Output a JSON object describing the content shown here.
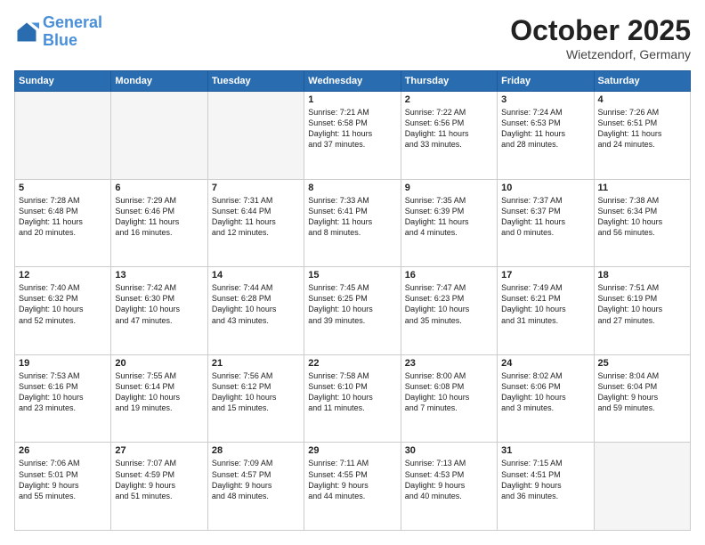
{
  "header": {
    "logo_line1": "General",
    "logo_line2": "Blue",
    "month": "October 2025",
    "location": "Wietzendorf, Germany"
  },
  "weekdays": [
    "Sunday",
    "Monday",
    "Tuesday",
    "Wednesday",
    "Thursday",
    "Friday",
    "Saturday"
  ],
  "weeks": [
    [
      {
        "day": "",
        "text": ""
      },
      {
        "day": "",
        "text": ""
      },
      {
        "day": "",
        "text": ""
      },
      {
        "day": "1",
        "text": "Sunrise: 7:21 AM\nSunset: 6:58 PM\nDaylight: 11 hours\nand 37 minutes."
      },
      {
        "day": "2",
        "text": "Sunrise: 7:22 AM\nSunset: 6:56 PM\nDaylight: 11 hours\nand 33 minutes."
      },
      {
        "day": "3",
        "text": "Sunrise: 7:24 AM\nSunset: 6:53 PM\nDaylight: 11 hours\nand 28 minutes."
      },
      {
        "day": "4",
        "text": "Sunrise: 7:26 AM\nSunset: 6:51 PM\nDaylight: 11 hours\nand 24 minutes."
      }
    ],
    [
      {
        "day": "5",
        "text": "Sunrise: 7:28 AM\nSunset: 6:48 PM\nDaylight: 11 hours\nand 20 minutes."
      },
      {
        "day": "6",
        "text": "Sunrise: 7:29 AM\nSunset: 6:46 PM\nDaylight: 11 hours\nand 16 minutes."
      },
      {
        "day": "7",
        "text": "Sunrise: 7:31 AM\nSunset: 6:44 PM\nDaylight: 11 hours\nand 12 minutes."
      },
      {
        "day": "8",
        "text": "Sunrise: 7:33 AM\nSunset: 6:41 PM\nDaylight: 11 hours\nand 8 minutes."
      },
      {
        "day": "9",
        "text": "Sunrise: 7:35 AM\nSunset: 6:39 PM\nDaylight: 11 hours\nand 4 minutes."
      },
      {
        "day": "10",
        "text": "Sunrise: 7:37 AM\nSunset: 6:37 PM\nDaylight: 11 hours\nand 0 minutes."
      },
      {
        "day": "11",
        "text": "Sunrise: 7:38 AM\nSunset: 6:34 PM\nDaylight: 10 hours\nand 56 minutes."
      }
    ],
    [
      {
        "day": "12",
        "text": "Sunrise: 7:40 AM\nSunset: 6:32 PM\nDaylight: 10 hours\nand 52 minutes."
      },
      {
        "day": "13",
        "text": "Sunrise: 7:42 AM\nSunset: 6:30 PM\nDaylight: 10 hours\nand 47 minutes."
      },
      {
        "day": "14",
        "text": "Sunrise: 7:44 AM\nSunset: 6:28 PM\nDaylight: 10 hours\nand 43 minutes."
      },
      {
        "day": "15",
        "text": "Sunrise: 7:45 AM\nSunset: 6:25 PM\nDaylight: 10 hours\nand 39 minutes."
      },
      {
        "day": "16",
        "text": "Sunrise: 7:47 AM\nSunset: 6:23 PM\nDaylight: 10 hours\nand 35 minutes."
      },
      {
        "day": "17",
        "text": "Sunrise: 7:49 AM\nSunset: 6:21 PM\nDaylight: 10 hours\nand 31 minutes."
      },
      {
        "day": "18",
        "text": "Sunrise: 7:51 AM\nSunset: 6:19 PM\nDaylight: 10 hours\nand 27 minutes."
      }
    ],
    [
      {
        "day": "19",
        "text": "Sunrise: 7:53 AM\nSunset: 6:16 PM\nDaylight: 10 hours\nand 23 minutes."
      },
      {
        "day": "20",
        "text": "Sunrise: 7:55 AM\nSunset: 6:14 PM\nDaylight: 10 hours\nand 19 minutes."
      },
      {
        "day": "21",
        "text": "Sunrise: 7:56 AM\nSunset: 6:12 PM\nDaylight: 10 hours\nand 15 minutes."
      },
      {
        "day": "22",
        "text": "Sunrise: 7:58 AM\nSunset: 6:10 PM\nDaylight: 10 hours\nand 11 minutes."
      },
      {
        "day": "23",
        "text": "Sunrise: 8:00 AM\nSunset: 6:08 PM\nDaylight: 10 hours\nand 7 minutes."
      },
      {
        "day": "24",
        "text": "Sunrise: 8:02 AM\nSunset: 6:06 PM\nDaylight: 10 hours\nand 3 minutes."
      },
      {
        "day": "25",
        "text": "Sunrise: 8:04 AM\nSunset: 6:04 PM\nDaylight: 9 hours\nand 59 minutes."
      }
    ],
    [
      {
        "day": "26",
        "text": "Sunrise: 7:06 AM\nSunset: 5:01 PM\nDaylight: 9 hours\nand 55 minutes."
      },
      {
        "day": "27",
        "text": "Sunrise: 7:07 AM\nSunset: 4:59 PM\nDaylight: 9 hours\nand 51 minutes."
      },
      {
        "day": "28",
        "text": "Sunrise: 7:09 AM\nSunset: 4:57 PM\nDaylight: 9 hours\nand 48 minutes."
      },
      {
        "day": "29",
        "text": "Sunrise: 7:11 AM\nSunset: 4:55 PM\nDaylight: 9 hours\nand 44 minutes."
      },
      {
        "day": "30",
        "text": "Sunrise: 7:13 AM\nSunset: 4:53 PM\nDaylight: 9 hours\nand 40 minutes."
      },
      {
        "day": "31",
        "text": "Sunrise: 7:15 AM\nSunset: 4:51 PM\nDaylight: 9 hours\nand 36 minutes."
      },
      {
        "day": "",
        "text": ""
      }
    ]
  ]
}
